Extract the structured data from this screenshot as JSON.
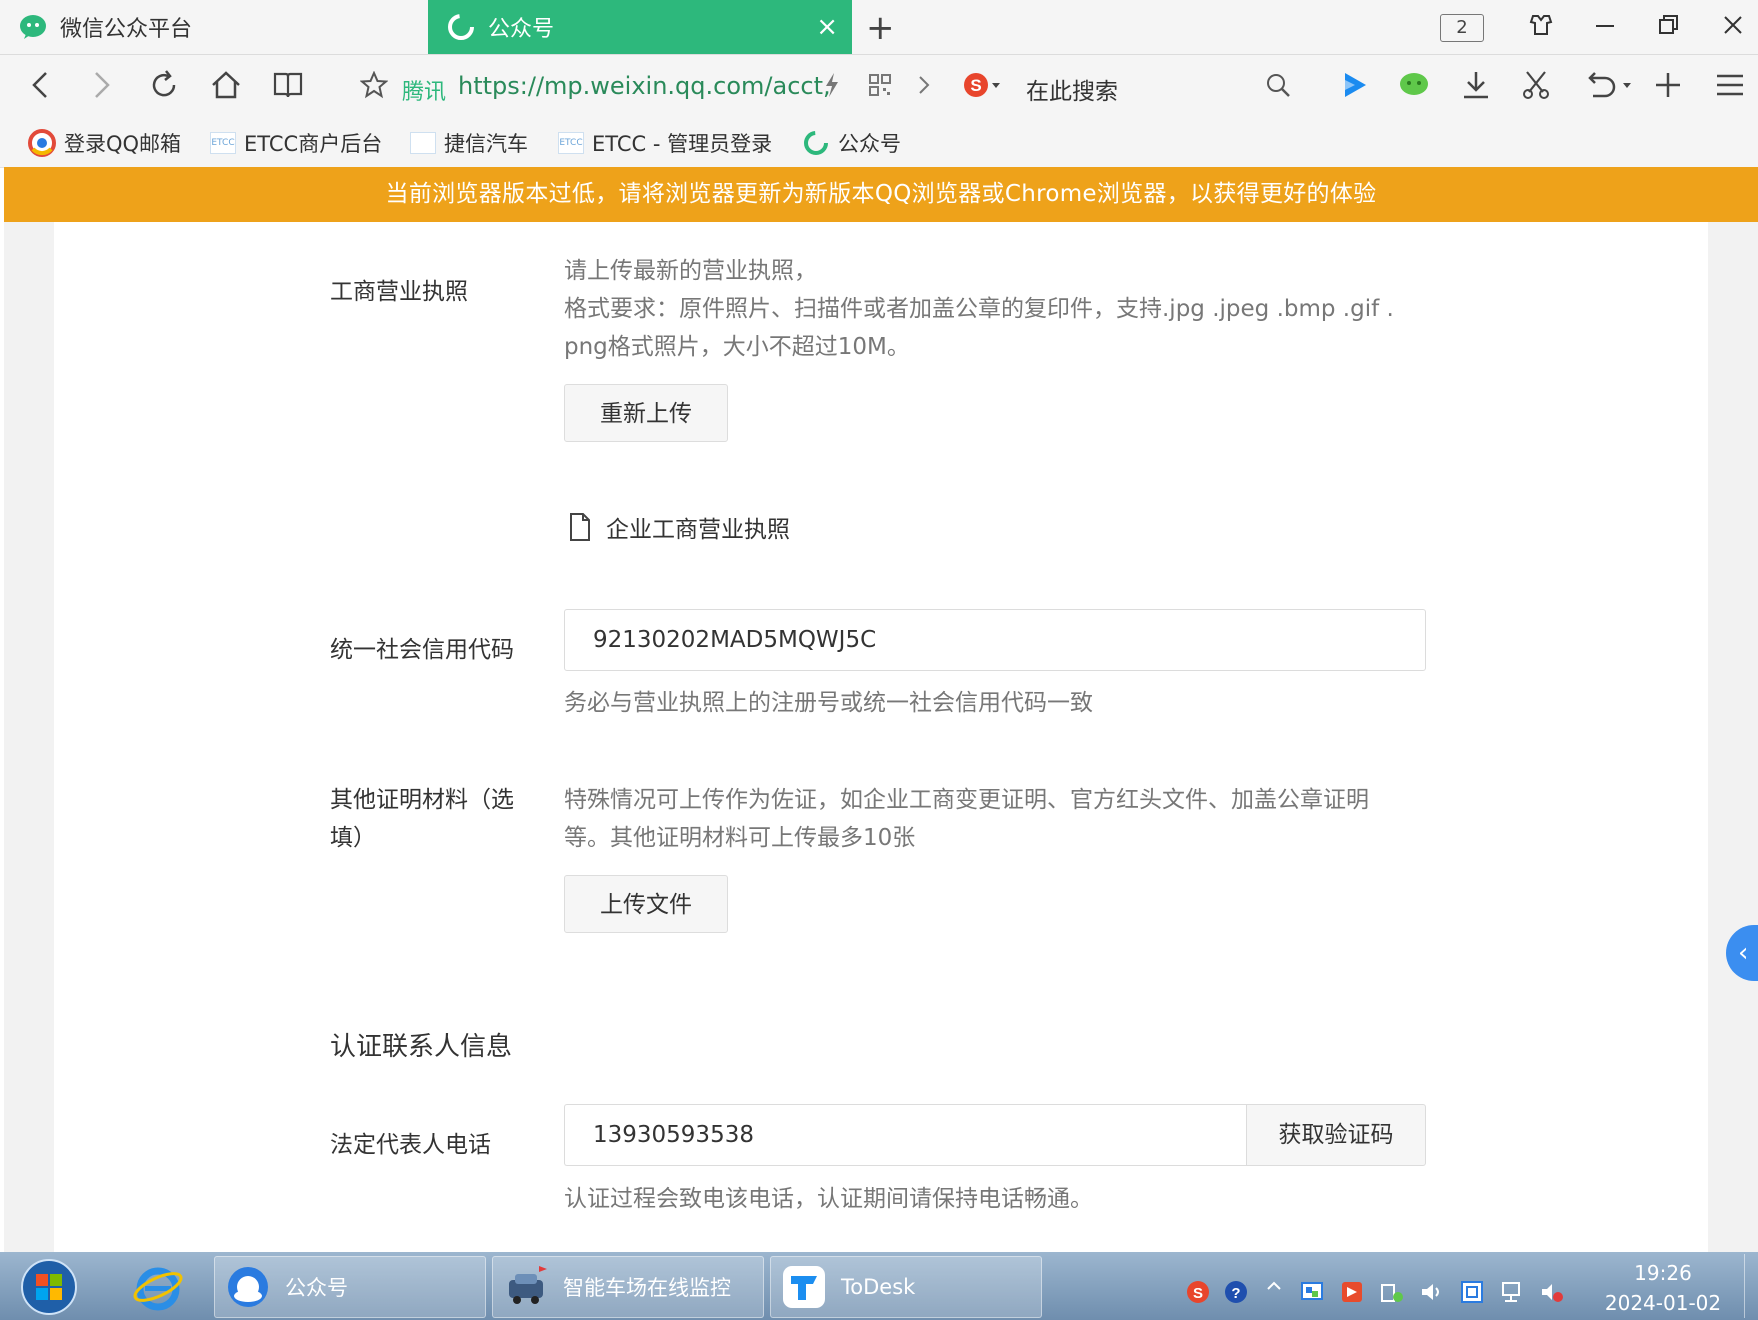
{
  "browser": {
    "tabs": [
      {
        "label": "微信公众平台",
        "active": false
      },
      {
        "label": "公众号",
        "active": true
      }
    ],
    "close_tab_glyph": "×",
    "new_tab_glyph": "+",
    "tab_count": "2",
    "url_source": "腾讯",
    "url": "https://mp.weixin.qq.com/acct,",
    "search_placeholder": "在此搜索",
    "bookmarks": [
      "登录QQ邮箱",
      "ETCC商户后台",
      "捷信汽车",
      "ETCC - 管理员登录",
      "公众号"
    ],
    "bookmark_icon_text": "ETCC",
    "accent_color": "#2db87c"
  },
  "banner": {
    "text": "当前浏览器版本过低，请将浏览器更新为新版本QQ浏览器或Chrome浏览器，以获得更好的体验",
    "color": "#eea21a"
  },
  "form": {
    "license": {
      "label": "工商营业执照",
      "hint_line1": "请上传最新的营业执照，",
      "hint_line2": "格式要求：原件照片、扫描件或者加盖公章的复印件，支持.jpg .jpeg .bmp .gif .",
      "hint_line3": "png格式照片，大小不超过10M。",
      "reupload_button": "重新上传",
      "file_name": "企业工商营业执照"
    },
    "credit_code": {
      "label": "统一社会信用代码",
      "value": "92130202MAD5MQWJ5C",
      "hint": "务必与营业执照上的注册号或统一社会信用代码一致"
    },
    "other_materials": {
      "label_line1": "其他证明材料（选",
      "label_line2": "填）",
      "hint_line1": "特殊情况可上传作为佐证，如企业工商变更证明、官方红头文件、加盖公章证明",
      "hint_line2": "等。其他证明材料可上传最多10张",
      "upload_button": "上传文件"
    },
    "contact_section_title": "认证联系人信息",
    "legal_phone": {
      "label": "法定代表人电话",
      "value": "13930593538",
      "get_code_button": "获取验证码",
      "hint": "认证过程会致电该电话，认证期间请保持电话畅通。"
    }
  },
  "side_toggle": "‹",
  "taskbar": {
    "items": [
      "公众号",
      "智能车场在线监控",
      "ToDesk"
    ],
    "time": "19:26",
    "date": "2024-01-02"
  }
}
